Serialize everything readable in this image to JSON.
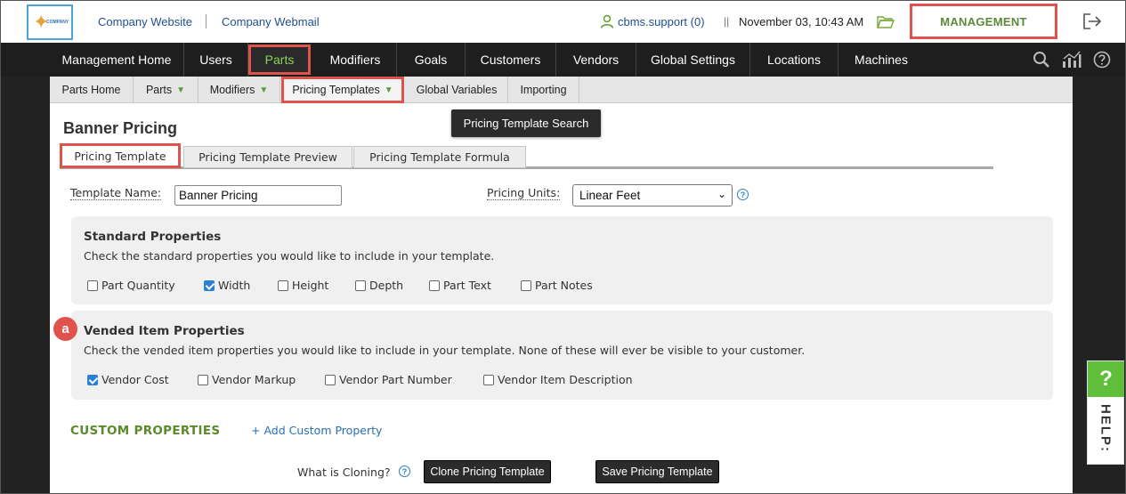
{
  "header": {
    "logo_text": "COMPANY",
    "links": [
      "Company Website",
      "Company Webmail"
    ],
    "username": "cbms.support (0)",
    "pipe": "||",
    "datetime": "November 03, 10:43 AM",
    "management_label": "MANAGEMENT"
  },
  "main_nav": {
    "items": [
      "Management Home",
      "Users",
      "Parts",
      "Modifiers",
      "Goals",
      "Customers",
      "Vendors",
      "Global Settings",
      "Locations",
      "Machines"
    ],
    "active": "Parts"
  },
  "sub_nav": {
    "items": [
      "Parts Home",
      "Parts",
      "Modifiers",
      "Pricing Templates",
      "Global Variables",
      "Importing"
    ],
    "active": "Pricing Templates"
  },
  "tooltip": "Pricing Template Search",
  "page": {
    "title": "Banner Pricing",
    "tabs": [
      "Pricing Template",
      "Pricing Template Preview",
      "Pricing Template Formula"
    ],
    "active_tab": "Pricing Template"
  },
  "form": {
    "template_name_label": "Template Name:",
    "template_name_value": "Banner Pricing",
    "pricing_units_label": "Pricing Units:",
    "pricing_units_value": "Linear Feet"
  },
  "standard_properties": {
    "title": "Standard Properties",
    "description": "Check the standard properties you would like to include in your template.",
    "options": [
      {
        "label": "Part Quantity",
        "checked": false
      },
      {
        "label": "Width",
        "checked": true
      },
      {
        "label": "Height",
        "checked": false
      },
      {
        "label": "Depth",
        "checked": false
      },
      {
        "label": "Part Text",
        "checked": false
      },
      {
        "label": "Part Notes",
        "checked": false
      }
    ]
  },
  "vended_properties": {
    "marker": "a",
    "title": "Vended Item Properties",
    "description": "Check the vended item properties you would like to include in your template. None of these will ever be visible to your customer.",
    "options": [
      {
        "label": "Vendor Cost",
        "checked": true
      },
      {
        "label": "Vendor Markup",
        "checked": false
      },
      {
        "label": "Vendor Part Number",
        "checked": false
      },
      {
        "label": "Vendor Item Description",
        "checked": false
      }
    ]
  },
  "custom_properties": {
    "title": "CUSTOM PROPERTIES",
    "add_label": "+ Add Custom Property"
  },
  "footer": {
    "cloning_question": "What is Cloning?",
    "clone_button": "Clone Pricing Template",
    "save_button": "Save Pricing Template"
  },
  "help_tab": {
    "question_mark": "?",
    "label": "HELP:"
  },
  "colors": {
    "highlight": "#e0524c",
    "nav_bg": "#1e1e1e",
    "active_green": "#8fd05a",
    "management_green": "#5a8a3a",
    "link_blue": "#1f4f8f",
    "checkbox_blue": "#2a7fd6"
  },
  "icons": [
    "user-icon",
    "folder-icon",
    "logout-icon",
    "search-icon",
    "bar-chart-icon",
    "help-icon"
  ]
}
